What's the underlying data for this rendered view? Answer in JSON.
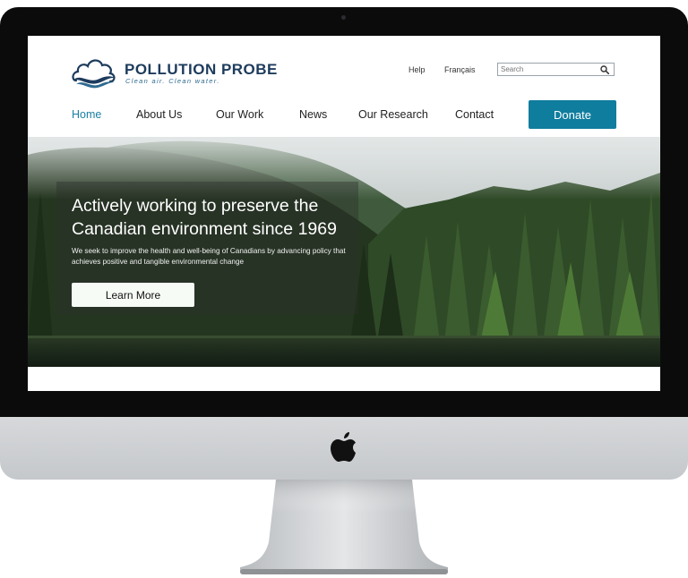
{
  "site": {
    "name": "POLLUTION PROBE",
    "tagline": "Clean air. Clean water."
  },
  "utility": {
    "help": "Help",
    "language": "Français",
    "search_placeholder": "Search"
  },
  "nav": {
    "items": [
      {
        "label": "Home",
        "active": true
      },
      {
        "label": "About Us",
        "active": false
      },
      {
        "label": "Our Work",
        "active": false
      },
      {
        "label": "News",
        "active": false
      },
      {
        "label": "Our Research",
        "active": false
      },
      {
        "label": "Contact",
        "active": false
      }
    ],
    "donate": "Donate"
  },
  "hero": {
    "title": "Actively working to preserve the Canadian environment since 1969",
    "subtitle": "We seek to improve the health and well-being of Canadians by advancing policy that achieves positive and tangible environmental change",
    "cta": "Learn More"
  },
  "colors": {
    "accent": "#0f7d9e",
    "brand_navy": "#1d3b5c",
    "active_nav": "#1b7fa3"
  },
  "icons": [
    "camera-icon",
    "logo-cloud-icon",
    "search-icon",
    "apple-logo-icon"
  ]
}
